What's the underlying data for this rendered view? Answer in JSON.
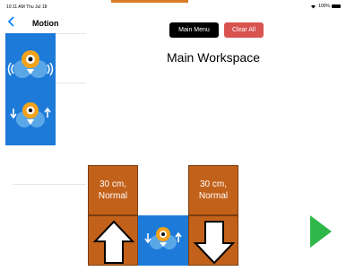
{
  "status_bar": {
    "time": "10:11 AM  Thu Jul 18",
    "battery": "100%"
  },
  "sidebar": {
    "title": "Motion"
  },
  "toolbar": {
    "main_menu_label": "Main Menu",
    "clear_all_label": "Clear All"
  },
  "workspace": {
    "title": "Main Workspace",
    "blocks": [
      {
        "distance": "30 cm,",
        "speed": "Normal",
        "direction": "forward"
      },
      {
        "type": "robot-move"
      },
      {
        "distance": "30 cm,",
        "speed": "Normal",
        "direction": "backward"
      }
    ]
  },
  "colors": {
    "block_orange": "#c2611a",
    "block_blue": "#1d7ad8",
    "play_green": "#2fb84a",
    "clear_red": "#d9534f"
  },
  "icons": [
    "back-chevron-icon",
    "robot-sound-icon",
    "robot-forward-backward-icon",
    "up-arrow-icon",
    "down-arrow-icon",
    "play-icon",
    "wifi-icon",
    "battery-icon"
  ]
}
